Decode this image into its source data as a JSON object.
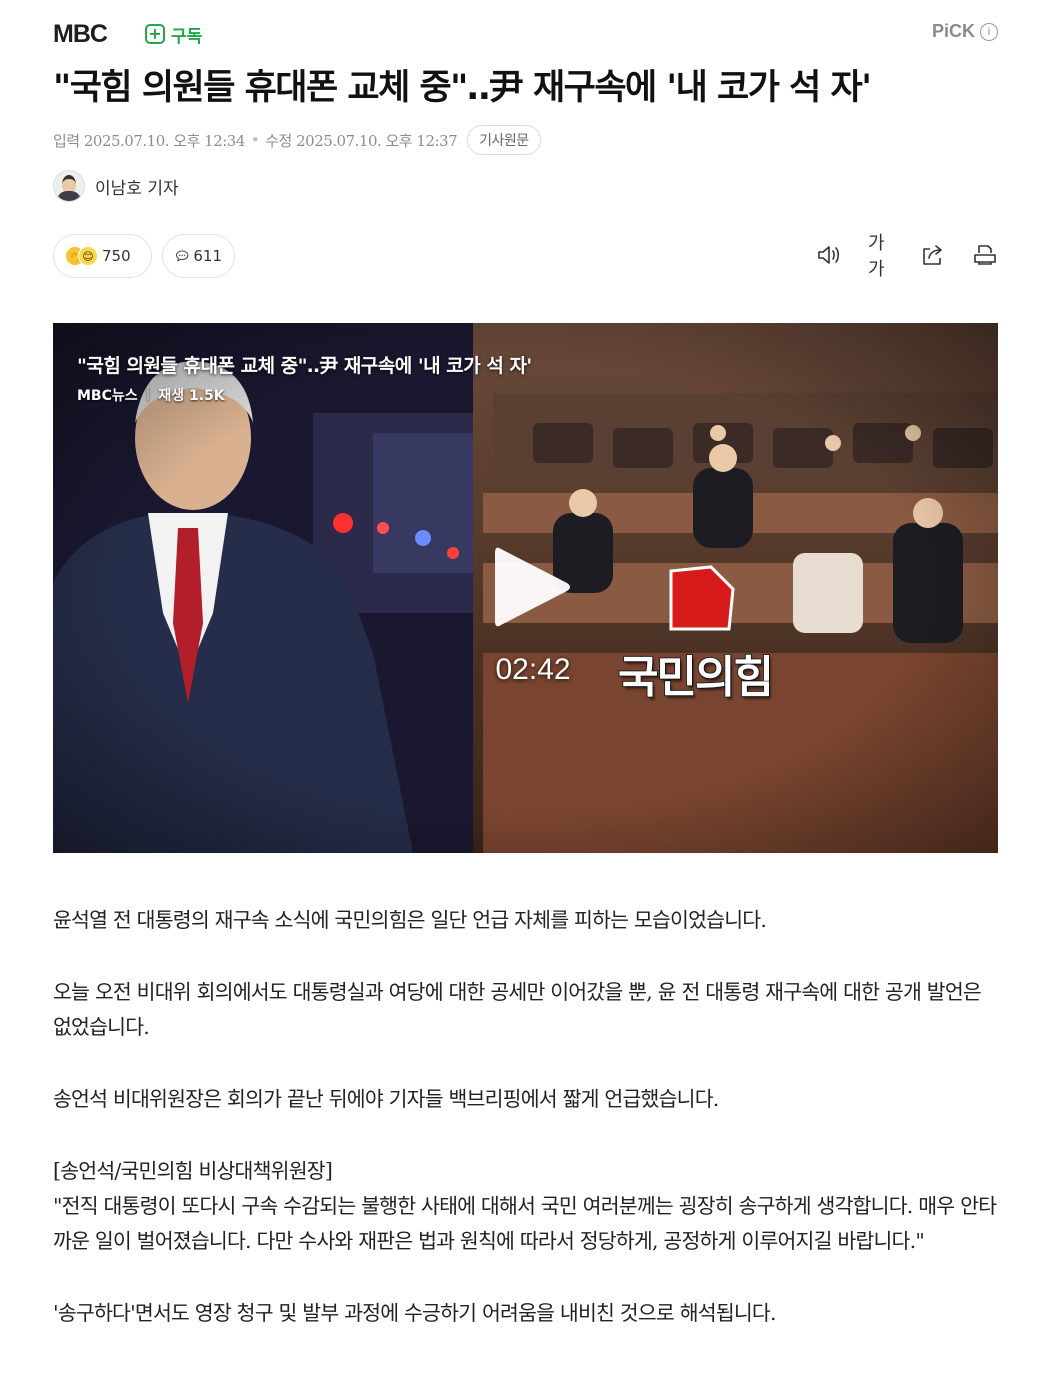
{
  "header": {
    "brand": "MBC",
    "subscribe_label": "구독",
    "pick_label": "PiCK"
  },
  "article": {
    "headline": "\"국힘 의원들 휴대폰 교체 중\"‥尹 재구속에 '내 코가 석 자'",
    "published": "입력 2025.07.10. 오후 12:34",
    "modified": "수정 2025.07.10. 오후 12:37",
    "original_link_label": "기사원문",
    "reporter": "이남호 기자"
  },
  "actions": {
    "reaction_count": "750",
    "comment_count": "611",
    "font_size_label": "가가"
  },
  "video": {
    "title": "\"국힘 의원들 휴대폰 교체 중\"‥尹 재구속에 '내 코가 석 자'",
    "channel": "MBC뉴스",
    "views": "재생 1.5K",
    "duration": "02:42",
    "overlay_text": "국민의힘",
    "party_color": "#d71b1b"
  },
  "body": {
    "p1": "윤석열 전 대통령의 재구속 소식에 국민의힘은 일단 언급 자체를 피하는 모습이었습니다.",
    "p2": "오늘 오전 비대위 회의에서도 대통령실과 여당에 대한 공세만 이어갔을 뿐, 윤 전 대통령 재구속에 대한 공개 발언은 없었습니다.",
    "p3": "송언석 비대위원장은 회의가 끝난 뒤에야 기자들 백브리핑에서 짧게 언급했습니다.",
    "quote_speaker": "[송언석/국민의힘 비상대책위원장]",
    "quote_text": "\"전직 대통령이 또다시 구속 수감되는 불행한 사태에 대해서 국민 여러분께는 굉장히 송구하게 생각합니다. 매우 안타까운 일이 벌어졌습니다. 다만 수사와 재판은 법과 원칙에 따라서 정당하게, 공정하게 이루어지길 바랍니다.\"",
    "p4": "'송구하다'면서도 영장 청구 및 발부 과정에 수긍하기 어려움을 내비친 것으로 해석됩니다."
  }
}
